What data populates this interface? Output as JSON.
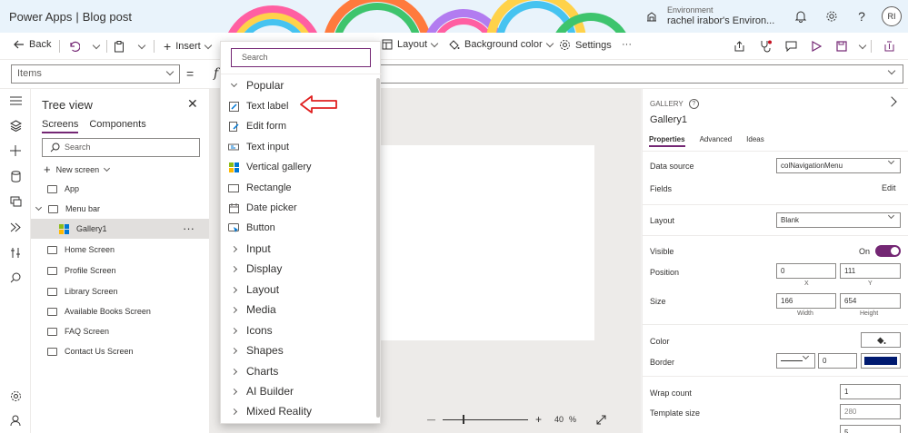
{
  "header": {
    "app": "Power Apps",
    "separator": "|",
    "document": "Blog post",
    "environment_label": "Environment",
    "environment_name": "rachel irabor's Environ...",
    "avatar_initials": "RI"
  },
  "toolbar": {
    "back": "Back",
    "insert": "Insert",
    "layout": "Layout",
    "background_color": "Background color",
    "settings": "Settings",
    "more": "···"
  },
  "formula": {
    "property": "Items",
    "equals": "=",
    "fx": "f"
  },
  "tree": {
    "title": "Tree view",
    "tabs": [
      "Screens",
      "Components"
    ],
    "search_placeholder": "Search",
    "new_screen": "New screen",
    "items": [
      {
        "label": "App"
      },
      {
        "label": "Menu bar"
      },
      {
        "label": "Gallery1",
        "more": "···"
      },
      {
        "label": "Home Screen"
      },
      {
        "label": "Profile Screen"
      },
      {
        "label": "Library Screen"
      },
      {
        "label": "Available Books Screen"
      },
      {
        "label": "FAQ Screen"
      },
      {
        "label": "Contact Us Screen"
      }
    ]
  },
  "insert_menu": {
    "search_placeholder": "Search",
    "popular": "Popular",
    "popular_items": [
      "Text label",
      "Edit form",
      "Text input",
      "Vertical gallery",
      "Rectangle",
      "Date picker",
      "Button"
    ],
    "categories": [
      "Input",
      "Display",
      "Layout",
      "Media",
      "Icons",
      "Shapes",
      "Charts",
      "AI Builder",
      "Mixed Reality"
    ]
  },
  "canvas": {
    "zoom_value": "40",
    "zoom_unit": "%",
    "minus": "—",
    "plus": "+"
  },
  "properties": {
    "type": "GALLERY",
    "help": "?",
    "name": "Gallery1",
    "tabs": [
      "Properties",
      "Advanced",
      "Ideas"
    ],
    "data_source_label": "Data source",
    "data_source_value": "colNavigationMenu",
    "fields_label": "Fields",
    "fields_action": "Edit",
    "layout_label": "Layout",
    "layout_value": "Blank",
    "visible_label": "Visible",
    "visible_state": "On",
    "position_label": "Position",
    "position_x": "0",
    "position_y": "111",
    "x_label": "X",
    "y_label": "Y",
    "size_label": "Size",
    "width": "166",
    "height": "654",
    "width_label": "Width",
    "height_label": "Height",
    "color_label": "Color",
    "border_label": "Border",
    "border_width": "0",
    "border_color": "#001a70",
    "wrap_count_label": "Wrap count",
    "wrap_count": "1",
    "template_size_label": "Template size",
    "template_size": "280",
    "template_padding_value": "5"
  },
  "colors": {
    "accent": "#742774",
    "annotation_arrow": "#e02020"
  }
}
